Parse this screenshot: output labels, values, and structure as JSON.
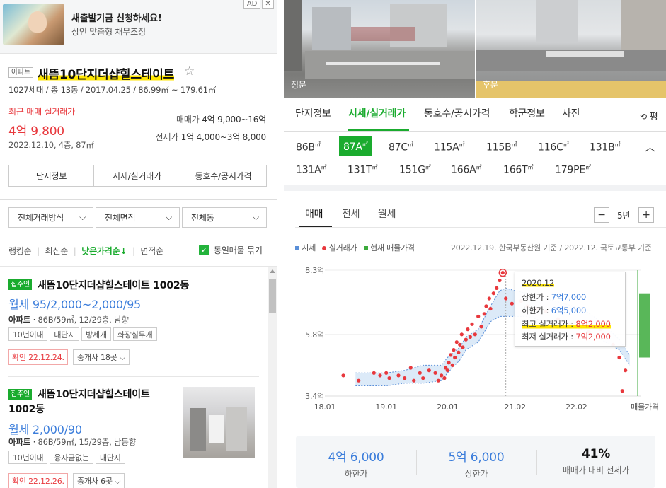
{
  "ad": {
    "badge": "AD",
    "close": "✕",
    "title": "새출발기금 신청하세요!",
    "subtitle": "상인 맞춤형 채무조정"
  },
  "complex": {
    "type_badge": "아파트",
    "name": "새뜸10단지더샵힐스테이트",
    "info": "1027세대 / 총 13동 / 2017.04.25 / 86.99㎡ ~ 179.61㎡",
    "recent_label": "최근 매매 실거래가",
    "recent_price": "4억 9,800",
    "recent_detail": "2022.12.10, 4층, 87㎡",
    "sale_label": "매매가",
    "sale_range": "4억 9,000~16억",
    "jeonse_label": "전세가",
    "jeonse_range": "1억 4,000~3억 8,000",
    "tabs": [
      "단지정보",
      "시세/실거래가",
      "동호수/공시가격"
    ]
  },
  "filters": {
    "deal_type": "전체거래방식",
    "area": "전체면적",
    "dong": "전체동"
  },
  "sort": {
    "options": [
      "랭킹순",
      "최신순",
      "낮은가격순↓",
      "면적순"
    ],
    "same_listing": "동일매물 묶기"
  },
  "listings": [
    {
      "badge": "집주인",
      "title": "새뜸10단지더샵힐스테이트 1002동",
      "price": "월세 95/2,000~2,000/95",
      "spec_type": "아파트",
      "spec": "86B/59㎡, 12/29층, 남향",
      "tags": [
        "10년이내",
        "대단지",
        "방세개",
        "화장실두개"
      ],
      "confirm": "확인 22.12.24.",
      "agents": "중개사 18곳"
    },
    {
      "badge": "집주인",
      "title": "새뜸10단지더샵힐스테이트 1002동",
      "price": "월세 2,000/90",
      "spec_type": "아파트",
      "spec": "86B/59㎡, 15/29층, 남동향",
      "tags": [
        "10년이내",
        "융자금없는",
        "대단지"
      ],
      "confirm": "확인 22.12.26.",
      "agents": "중개사 6곳"
    }
  ],
  "photos": {
    "left_label": "정문",
    "right_label": "후문"
  },
  "main_tabs": [
    "단지정보",
    "시세/실거래가",
    "동호수/공시가격",
    "학군정보",
    "사진"
  ],
  "main_tab_extra": "평",
  "areas_row1": [
    {
      "label": "86B",
      "active": false
    },
    {
      "label": "87A",
      "active": true
    },
    {
      "label": "87C",
      "active": false
    },
    {
      "label": "115A",
      "active": false
    },
    {
      "label": "115B",
      "active": false
    },
    {
      "label": "116C",
      "active": false
    },
    {
      "label": "131B",
      "active": false
    }
  ],
  "areas_row2": [
    "131A",
    "131T",
    "151G",
    "166A",
    "166T",
    "179PE"
  ],
  "area_unit": "㎡",
  "deal_tabs": [
    "매매",
    "전세",
    "월세"
  ],
  "period": {
    "minus": "−",
    "value": "5년",
    "plus": "+"
  },
  "legend": {
    "market": "시세",
    "real": "실거래가",
    "current": "현재 매물가격",
    "source": "2022.12.19. 한국부동산원 기준 / 2022.12. 국토교통부 기준"
  },
  "tooltip": {
    "date": "2020.12",
    "upper_label": "상한가 : ",
    "upper_value": "7억7,000",
    "lower_label": "하한가 : ",
    "lower_value": "6억5,000",
    "max_label": "최고 실거래가 : ",
    "max_value": "8억2,000",
    "min_label": "최저 실거래가 : ",
    "min_value": "7억2,000"
  },
  "chart_data": {
    "type": "line",
    "y_tick_labels": [
      "8.3억",
      "5.8억",
      "3.4억"
    ],
    "x_tick_labels": [
      "18.01",
      "19.01",
      "20.01",
      "21.02",
      "22.02",
      "매물가격"
    ],
    "ylim": [
      3.4,
      8.3
    ],
    "xlim": [
      2018.0,
      2023.1
    ],
    "series": [
      {
        "name": "시세",
        "upper": [
          [
            2018.5,
            4.3
          ],
          [
            2019.0,
            4.3
          ],
          [
            2019.3,
            4.4
          ],
          [
            2019.6,
            4.6
          ],
          [
            2019.9,
            4.6
          ],
          [
            2020.0,
            4.9
          ],
          [
            2020.2,
            5.3
          ],
          [
            2020.3,
            5.7
          ],
          [
            2020.5,
            6.0
          ],
          [
            2020.7,
            6.9
          ],
          [
            2020.85,
            7.5
          ],
          [
            2020.95,
            7.6
          ],
          [
            2021.1,
            7.5
          ],
          [
            2021.3,
            7.4
          ],
          [
            2021.6,
            7.2
          ],
          [
            2021.9,
            7.0
          ],
          [
            2022.2,
            6.8
          ],
          [
            2022.5,
            6.3
          ],
          [
            2022.8,
            5.6
          ],
          [
            2022.97,
            5.0
          ]
        ],
        "lower": [
          [
            2018.5,
            3.8
          ],
          [
            2019.0,
            3.8
          ],
          [
            2019.3,
            3.9
          ],
          [
            2019.6,
            3.9
          ],
          [
            2019.9,
            4.0
          ],
          [
            2020.0,
            4.3
          ],
          [
            2020.2,
            4.8
          ],
          [
            2020.3,
            5.2
          ],
          [
            2020.5,
            5.5
          ],
          [
            2020.7,
            6.3
          ],
          [
            2020.85,
            6.5
          ],
          [
            2020.95,
            6.5
          ],
          [
            2021.1,
            6.5
          ],
          [
            2021.3,
            6.5
          ],
          [
            2021.6,
            6.3
          ],
          [
            2021.9,
            6.1
          ],
          [
            2022.2,
            6.0
          ],
          [
            2022.5,
            5.6
          ],
          [
            2022.8,
            5.2
          ],
          [
            2022.97,
            4.6
          ]
        ]
      },
      {
        "name": "실거래가",
        "points": [
          [
            2018.3,
            4.2
          ],
          [
            2018.55,
            4.0
          ],
          [
            2018.8,
            4.3
          ],
          [
            2018.9,
            4.2
          ],
          [
            2019.0,
            4.3
          ],
          [
            2019.05,
            4.1
          ],
          [
            2019.2,
            4.2
          ],
          [
            2019.3,
            4.1
          ],
          [
            2019.4,
            4.5
          ],
          [
            2019.45,
            4.0
          ],
          [
            2019.55,
            4.3
          ],
          [
            2019.6,
            4.1
          ],
          [
            2019.7,
            4.4
          ],
          [
            2019.8,
            4.3
          ],
          [
            2019.85,
            4.0
          ],
          [
            2019.9,
            4.2
          ],
          [
            2019.95,
            4.1
          ],
          [
            2019.97,
            4.5
          ],
          [
            2020.0,
            4.4
          ],
          [
            2020.02,
            4.7
          ],
          [
            2020.05,
            5.0
          ],
          [
            2020.08,
            4.6
          ],
          [
            2020.1,
            5.2
          ],
          [
            2020.12,
            4.9
          ],
          [
            2020.15,
            5.5
          ],
          [
            2020.18,
            5.1
          ],
          [
            2020.2,
            5.4
          ],
          [
            2020.23,
            5.8
          ],
          [
            2020.25,
            5.3
          ],
          [
            2020.3,
            5.6
          ],
          [
            2020.33,
            6.0
          ],
          [
            2020.37,
            5.7
          ],
          [
            2020.4,
            6.2
          ],
          [
            2020.45,
            5.8
          ],
          [
            2020.5,
            6.5
          ],
          [
            2020.55,
            6.1
          ],
          [
            2020.6,
            6.6
          ],
          [
            2020.63,
            6.9
          ],
          [
            2020.68,
            7.2
          ],
          [
            2020.7,
            6.8
          ],
          [
            2020.75,
            7.4
          ],
          [
            2020.8,
            7.6
          ],
          [
            2020.85,
            7.9
          ],
          [
            2020.9,
            8.2
          ],
          [
            2020.95,
            7.2
          ],
          [
            2021.05,
            7.0
          ],
          [
            2021.2,
            7.1
          ],
          [
            2021.3,
            6.9
          ],
          [
            2021.45,
            6.8
          ],
          [
            2021.6,
            6.7
          ],
          [
            2021.8,
            6.4
          ],
          [
            2022.0,
            6.2
          ],
          [
            2022.15,
            6.1
          ],
          [
            2022.3,
            5.9
          ],
          [
            2022.5,
            6.0
          ],
          [
            2022.7,
            5.4
          ],
          [
            2022.8,
            4.9
          ],
          [
            2022.85,
            3.6
          ],
          [
            2022.9,
            4.4
          ]
        ]
      },
      {
        "name": "현재 매물가격",
        "range": [
          4.9,
          7.4
        ]
      }
    ],
    "highlight_x": 2020.95,
    "colors": {
      "market_line": "#5a8fd8",
      "market_fill": "#dceaf8",
      "real": "#e8383d",
      "current": "#3caa3c"
    }
  },
  "summary": [
    {
      "value": "4억 6,000",
      "label": "하한가"
    },
    {
      "value": "5억 6,000",
      "label": "상한가"
    },
    {
      "value": "41%",
      "label": "매매가 대비 전세가"
    }
  ]
}
